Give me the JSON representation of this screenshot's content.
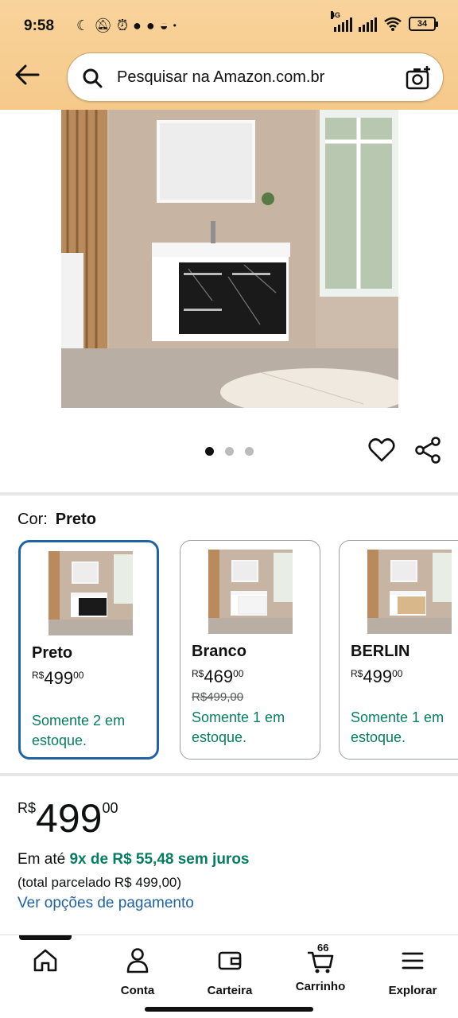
{
  "status_bar": {
    "time": "9:58",
    "network_label": "4G",
    "battery": "34"
  },
  "search": {
    "placeholder": "Pesquisar na Amazon.com.br"
  },
  "image_carousel": {
    "total": 3,
    "active_index": 0
  },
  "color_selector": {
    "label": "Cor:",
    "selected": "Preto"
  },
  "variants": [
    {
      "name": "Preto",
      "currency": "R$",
      "price_int": "499",
      "price_cents": "00",
      "strike_price": "",
      "stock": "Somente 2 em estoque.",
      "cabinet_color": "#1a1a1a"
    },
    {
      "name": "Branco",
      "currency": "R$",
      "price_int": "469",
      "price_cents": "00",
      "strike_price": "R$499,00",
      "stock": "Somente 1 em estoque.",
      "cabinet_color": "#f4f4f4"
    },
    {
      "name": "BERLIN",
      "currency": "R$",
      "price_int": "499",
      "price_cents": "00",
      "strike_price": "",
      "stock": "Somente 1 em estoque.",
      "cabinet_color": "#d8b88a"
    }
  ],
  "price": {
    "currency": "R$",
    "int": "499",
    "cents": "00"
  },
  "installments": {
    "prefix": "Em até",
    "highlight": "9x de R$ 55,48 sem juros",
    "total": "(total parcelado R$ 499,00)",
    "link": "Ver opções de pagamento"
  },
  "nav": {
    "home": "",
    "account": "Conta",
    "wallet": "Carteira",
    "cart": "Carrinho",
    "cart_count": "66",
    "explore": "Explorar"
  },
  "colors": {
    "header": "#f8d39b",
    "link": "#2162a1",
    "success": "#067d62",
    "selected_border": "#2162a1"
  }
}
